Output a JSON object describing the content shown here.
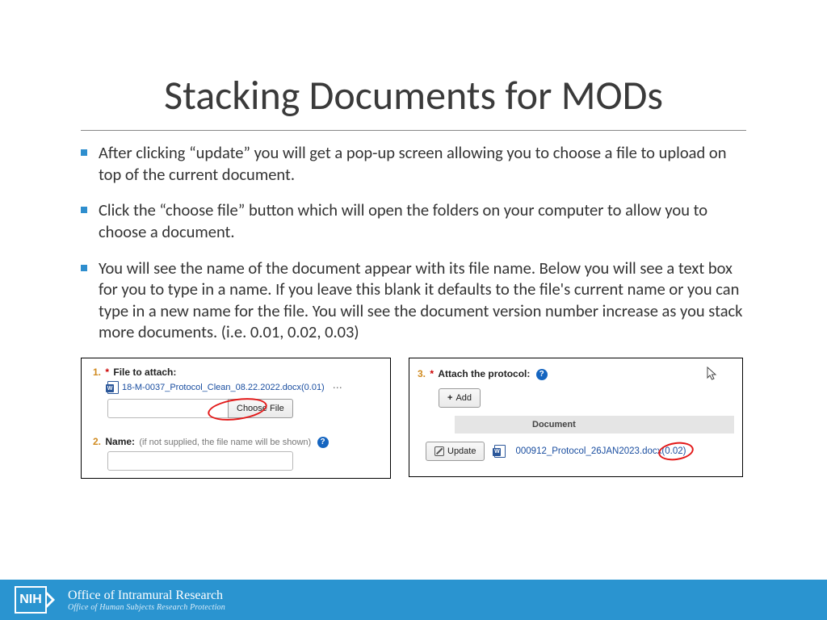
{
  "title": "Stacking Documents for MODs",
  "bullets": [
    "After clicking “update” you will get a pop-up screen allowing you to choose a file to upload on top of the current document.",
    "Click the “choose file” button which will open the folders on your computer to allow you to choose a document.",
    "You will see the name of the document appear with its file name. Below you will see a text box for you to type in a name. If you leave this blank it defaults to the file's current name or you can type in a new name for the file. You will see the document version number increase as you stack more documents. (i.e. 0.01, 0.02, 0.03)"
  ],
  "shot1": {
    "row1": {
      "num": "1.",
      "label": "File to attach:"
    },
    "doc_name": "18-M-0037_Protocol_Clean_08.22.2022.docx(0.01)",
    "choose_label": "Choose File",
    "row2": {
      "num": "2.",
      "label": "Name:",
      "sub": "(if not supplied, the file name will be shown)"
    }
  },
  "shot2": {
    "head": {
      "num": "3.",
      "label": "Attach the protocol:"
    },
    "add_label": "Add",
    "col_header": "Document",
    "update_label": "Update",
    "doc_name": "000912_Protocol_26JAN2023.docx(0.02)"
  },
  "footer": {
    "nih": "NIH",
    "org_main": "Office of Intramural Research",
    "org_sub": "Office of Human Subjects Research Protection"
  }
}
